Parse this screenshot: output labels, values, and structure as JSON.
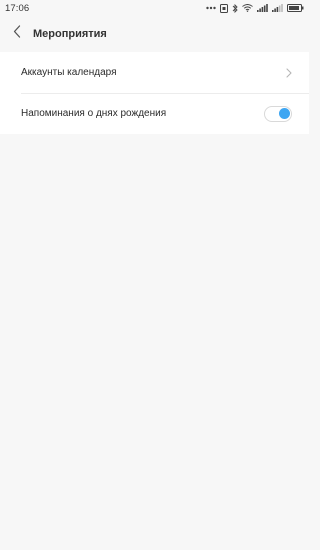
{
  "status_bar": {
    "time": "17:06",
    "icons": [
      "dots-icon",
      "sim-icon",
      "bluetooth-icon",
      "wifi-icon",
      "signal-icon",
      "signal-icon",
      "battery-icon"
    ]
  },
  "header": {
    "title": "Мероприятия",
    "back_icon": "back-chevron-icon"
  },
  "settings": {
    "items": [
      {
        "label": "Аккаунты календаря",
        "control": "chevron-right-icon"
      },
      {
        "label": "Напоминания о днях рождения",
        "control": "toggle",
        "toggle_on": true
      }
    ]
  },
  "colors": {
    "background": "#f7f7f7",
    "card": "#ffffff",
    "accent": "#3ea6f2"
  }
}
